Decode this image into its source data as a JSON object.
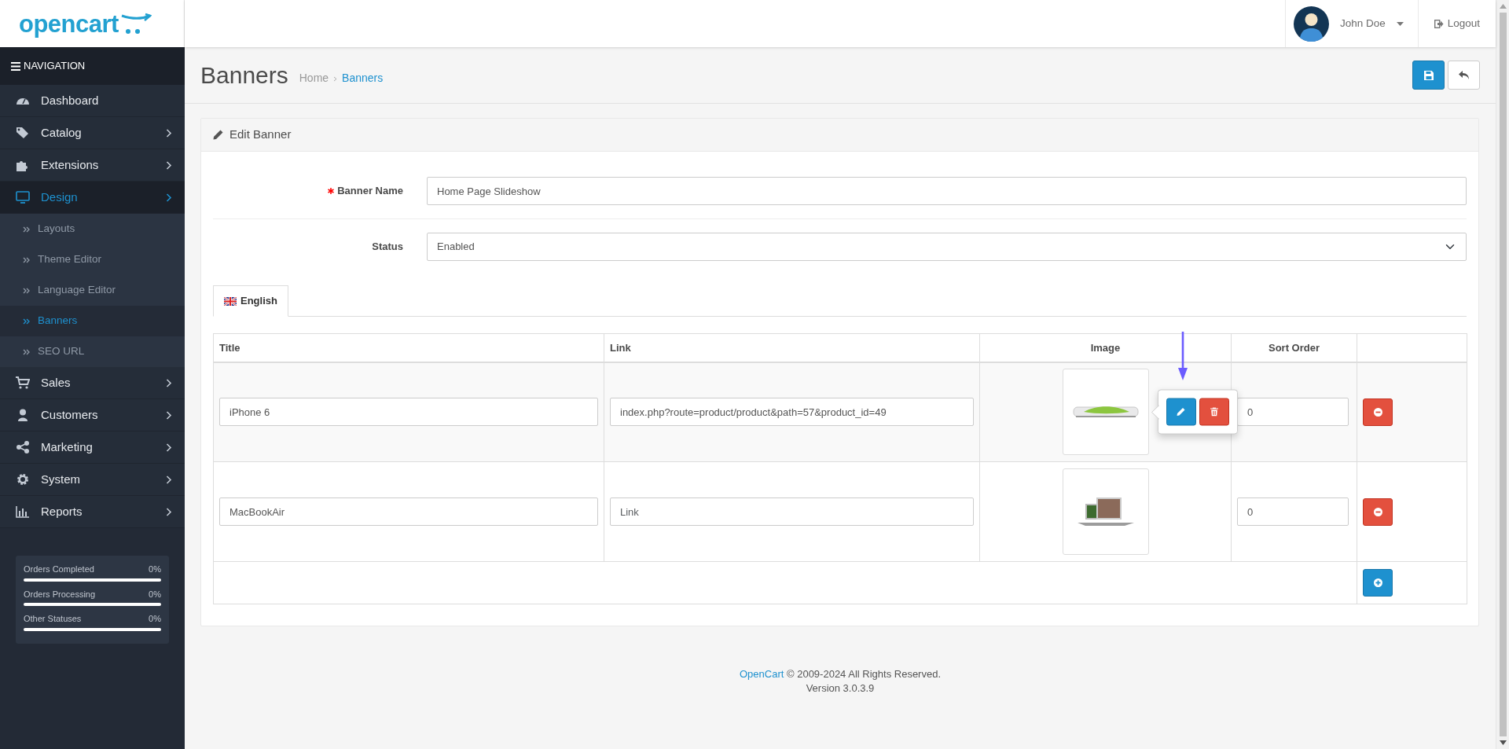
{
  "header": {
    "logo": "opencart",
    "user": "John Doe",
    "logout": "Logout"
  },
  "sidebar": {
    "heading": "NAVIGATION",
    "items": [
      {
        "label": "Dashboard",
        "has_submenu": false,
        "selected": false
      },
      {
        "label": "Catalog",
        "has_submenu": true,
        "selected": false
      },
      {
        "label": "Extensions",
        "has_submenu": true,
        "selected": false
      },
      {
        "label": "Design",
        "has_submenu": true,
        "selected": true,
        "expanded": true,
        "children": [
          {
            "label": "Layouts",
            "selected": false
          },
          {
            "label": "Theme Editor",
            "selected": false
          },
          {
            "label": "Language Editor",
            "selected": false
          },
          {
            "label": "Banners",
            "selected": true
          },
          {
            "label": "SEO URL",
            "selected": false
          }
        ]
      },
      {
        "label": "Sales",
        "has_submenu": true,
        "selected": false
      },
      {
        "label": "Customers",
        "has_submenu": true,
        "selected": false
      },
      {
        "label": "Marketing",
        "has_submenu": true,
        "selected": false
      },
      {
        "label": "System",
        "has_submenu": true,
        "selected": false
      },
      {
        "label": "Reports",
        "has_submenu": true,
        "selected": false
      }
    ],
    "stats": [
      {
        "label": "Orders Completed",
        "reading": "0%",
        "level": 0
      },
      {
        "label": "Orders Processing",
        "reading": "0%",
        "level": 0
      },
      {
        "label": "Other Statuses",
        "reading": "0%",
        "level": 0
      }
    ]
  },
  "page": {
    "title": "Banners",
    "breadcrumb": [
      "Home",
      "Banners"
    ]
  },
  "panel": {
    "title": "Edit Banner",
    "fields": [
      {
        "kind": "text",
        "label": "Banner Name",
        "required": true,
        "value": "Home Page Slideshow"
      },
      {
        "kind": "select",
        "label": "Status",
        "required": false,
        "value": "Enabled"
      }
    ],
    "tabs": [
      {
        "label": "English",
        "selected": true
      }
    ],
    "table": {
      "columns": [
        "Title",
        "Link",
        "Image",
        "Sort Order"
      ],
      "rows": [
        {
          "title": "iPhone 6",
          "link": "index.php?route=product/product&path=57&product_id=49",
          "sort_order": "0",
          "highlighted": true,
          "popover_open": true
        },
        {
          "title": "MacBookAir",
          "link_placeholder": "Link",
          "sort_order": "0",
          "highlighted": false,
          "popover_open": false
        }
      ]
    }
  },
  "footer": {
    "link": "OpenCart",
    "text": "© 2009-2024 All Rights Reserved.",
    "version": "Version 3.0.3.9"
  }
}
